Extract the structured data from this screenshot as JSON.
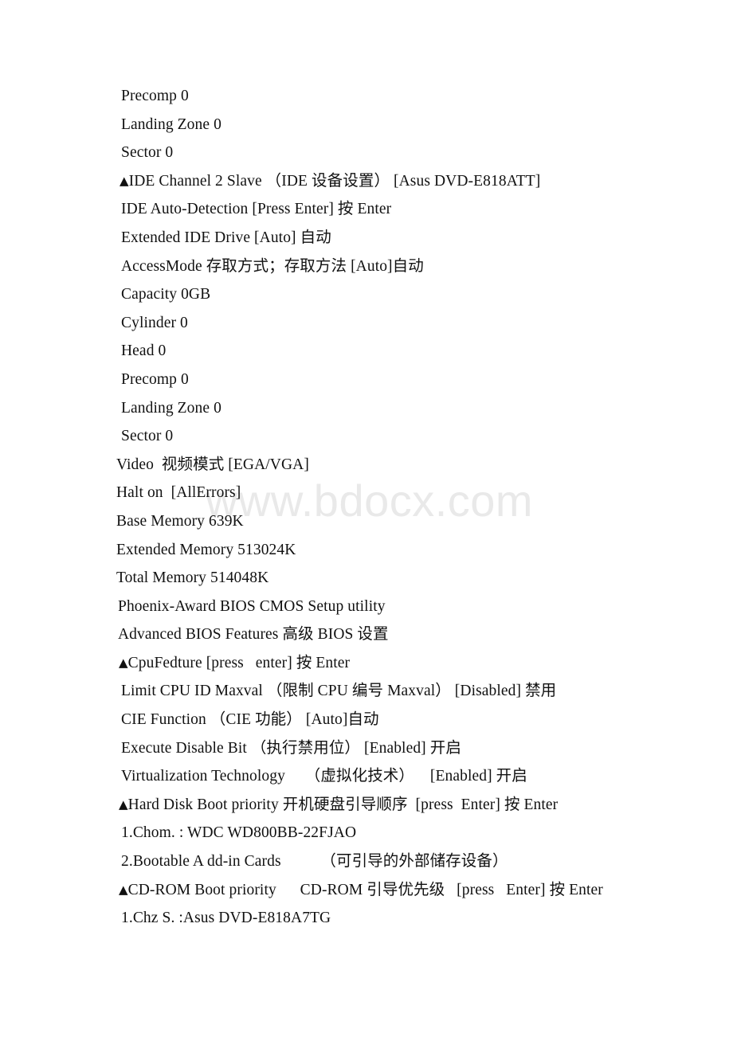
{
  "page": {
    "background_color": "#ffffff",
    "text_color": "#111111"
  },
  "watermark": {
    "text": "www.bdocx.com",
    "color": "#e9e9e9"
  },
  "document": {
    "lines": [
      {
        "id": "precomp-1",
        "text": "Precomp 0",
        "indent": "ind-b",
        "bullet": false
      },
      {
        "id": "landing-zone-1",
        "text": "Landing Zone 0",
        "indent": "ind-b",
        "bullet": false
      },
      {
        "id": "sector-1",
        "text": "Sector 0",
        "indent": "ind-b",
        "bullet": false
      },
      {
        "id": "ide-channel-2-slave",
        "text": "IDE Channel 2 Slave （IDE 设备设置） [Asus DVD-E818ATT]",
        "indent": "ind-a",
        "bullet": true
      },
      {
        "id": "ide-auto-detection",
        "text": "IDE Auto-Detection [Press Enter] 按 Enter",
        "indent": "ind-b",
        "bullet": false
      },
      {
        "id": "extended-ide-drive",
        "text": "Extended IDE Drive [Auto] 自动",
        "indent": "ind-b",
        "bullet": false
      },
      {
        "id": "access-mode",
        "text": "AccessMode 存取方式；存取方法 [Auto]自动",
        "indent": "ind-b",
        "bullet": false
      },
      {
        "id": "capacity",
        "text": "Capacity 0GB",
        "indent": "ind-b",
        "bullet": false
      },
      {
        "id": "cylinder",
        "text": "Cylinder 0",
        "indent": "ind-b",
        "bullet": false
      },
      {
        "id": "head",
        "text": "Head 0",
        "indent": "ind-b",
        "bullet": false
      },
      {
        "id": "precomp-2",
        "text": "Precomp 0",
        "indent": "ind-b",
        "bullet": false
      },
      {
        "id": "landing-zone-2",
        "text": "Landing Zone 0",
        "indent": "ind-b",
        "bullet": false
      },
      {
        "id": "sector-2",
        "text": "Sector 0",
        "indent": "ind-b",
        "bullet": false
      },
      {
        "id": "video",
        "text": "Video  视频模式 [EGA/VGA]",
        "indent": "ind-c",
        "bullet": false
      },
      {
        "id": "halt-on",
        "text": "Halt on  [AllErrors]",
        "indent": "ind-c",
        "bullet": false
      },
      {
        "id": "base-memory",
        "text": "Base Memory 639K",
        "indent": "ind-c",
        "bullet": false
      },
      {
        "id": "extended-memory",
        "text": "Extended Memory 513024K",
        "indent": "ind-c",
        "bullet": false
      },
      {
        "id": "total-memory",
        "text": "Total Memory 514048K",
        "indent": "ind-c",
        "bullet": false
      },
      {
        "id": "phoenix-award-title",
        "text": "Phoenix-Award BIOS CMOS Setup utility",
        "indent": "ind-d",
        "bullet": false
      },
      {
        "id": "advanced-bios-features",
        "text": "Advanced BIOS Features 高级 BIOS 设置",
        "indent": "ind-d",
        "bullet": false
      },
      {
        "id": "cpu-fedture",
        "text": "CpuFedture [press   enter] 按 Enter",
        "indent": "ind-e",
        "bullet": true
      },
      {
        "id": "limit-cpu-id-maxval",
        "text": "Limit CPU ID Maxval （限制 CPU 编号 Maxval） [Disabled] 禁用",
        "indent": "ind-b",
        "bullet": false
      },
      {
        "id": "cie-function",
        "text": "CIE Function （CIE 功能） [Auto]自动",
        "indent": "ind-b",
        "bullet": false
      },
      {
        "id": "execute-disable-bit",
        "text": "Execute Disable Bit （执行禁用位） [Enabled] 开启",
        "indent": "ind-b",
        "bullet": false
      },
      {
        "id": "virtualization-tech",
        "text": "Virtualization Technology     （虚拟化技术）    [Enabled] 开启",
        "indent": "ind-b",
        "bullet": false
      },
      {
        "id": "hard-disk-boot-priority",
        "text": "Hard Disk Boot priority 开机硬盘引导顺序  [press  Enter] 按 Enter",
        "indent": "ind-e",
        "bullet": true
      },
      {
        "id": "hdd-entry-1",
        "text": "1.Chom. : WDC WD800BB-22FJAO",
        "indent": "ind-b",
        "bullet": false
      },
      {
        "id": "hdd-entry-2",
        "text": "2.Bootable A dd-in Cards          （可引导的外部储存设备）",
        "indent": "ind-b",
        "bullet": false
      },
      {
        "id": "cdrom-boot-priority",
        "text": "CD-ROM Boot priority      CD-ROM 引导优先级   [press   Enter] 按 Enter",
        "indent": "ind-e",
        "bullet": true
      },
      {
        "id": "cdrom-entry-1",
        "text": "1.Chz S. :Asus DVD-E818A7TG",
        "indent": "ind-b",
        "bullet": false
      }
    ]
  }
}
